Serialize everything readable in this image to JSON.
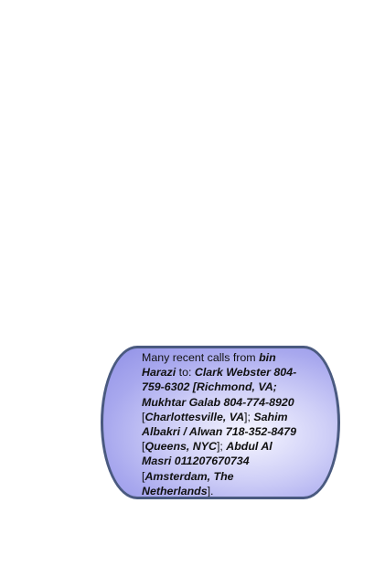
{
  "callout": {
    "segments": [
      {
        "text": "Many recent calls from ",
        "bold": false
      },
      {
        "text": "bin Harazi",
        "bold": true
      },
      {
        "text": " to: ",
        "bold": false
      },
      {
        "text": "Clark Webster 804-759-6302 [Richmond, VA; Mukhtar Galab 804-774-8920",
        "bold": true
      },
      {
        "text": " [",
        "bold": false
      },
      {
        "text": "Charlottesville, VA",
        "bold": true
      },
      {
        "text": "]; ",
        "bold": false
      },
      {
        "text": "Sahim Albakri / Alwan 718-352-8479",
        "bold": true
      },
      {
        "text": " [",
        "bold": false
      },
      {
        "text": "Queens, NYC",
        "bold": true
      },
      {
        "text": "]; ",
        "bold": false
      },
      {
        "text": "Abdul Al Masri 011207670734",
        "bold": true
      },
      {
        "text": " [",
        "bold": false
      },
      {
        "text": "Amsterdam, The Netherlands",
        "bold": true
      },
      {
        "text": "].",
        "bold": false
      }
    ]
  },
  "colors": {
    "node_border": "#4a5a80",
    "node_fill_edge": "#8f8fe6",
    "node_fill_center": "#f6f6ff"
  }
}
